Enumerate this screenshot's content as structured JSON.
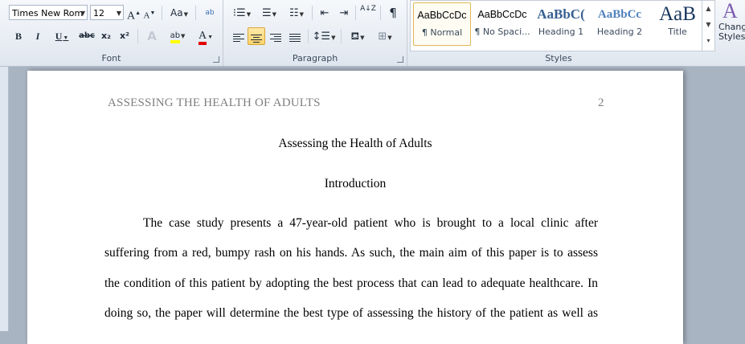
{
  "ribbon": {
    "font": {
      "family_value": "Times New Rom",
      "size_value": "12",
      "grow_label": "A",
      "shrink_label": "A",
      "case_label": "Aa",
      "clear_label": "ab",
      "bold_label": "B",
      "italic_label": "I",
      "underline_label": "U",
      "strike_label": "abc",
      "subscript_label": "x₂",
      "superscript_label": "x²",
      "effects_label": "A",
      "highlight_label": "ab",
      "color_label": "A",
      "group_label": "Font",
      "highlight_color": "#ffff00",
      "font_color": "#e00000"
    },
    "paragraph": {
      "sort_label": "A↓Z",
      "pilcrow_label": "¶",
      "group_label": "Paragraph"
    },
    "styles": {
      "items": [
        {
          "preview": "AaBbCcDc",
          "name": "¶ Normal"
        },
        {
          "preview": "AaBbCcDc",
          "name": "¶ No Spaci..."
        },
        {
          "preview": "AaBbC(",
          "name": "Heading 1"
        },
        {
          "preview": "AaBbCc",
          "name": "Heading 2"
        },
        {
          "preview": "AaB",
          "name": "Title"
        }
      ],
      "group_label": "Styles",
      "change_label_1": "Chang",
      "change_label_2": "Styles"
    }
  },
  "document": {
    "header_text": "ASSESSING THE HEALTH OF ADULTS",
    "page_number": "2",
    "title": "Assessing the Health of Adults",
    "section_heading": "Introduction",
    "body_lines": [
      "The case study presents a 47-year-old patient who is brought to a local clinic after",
      "suffering from a red, bumpy rash on his hands. As such, the main aim of this paper is to assess",
      "the condition of this patient by adopting the best process that can lead to adequate healthcare. In",
      "doing so, the paper will determine the best type of assessing the history of the patient as well as"
    ]
  }
}
